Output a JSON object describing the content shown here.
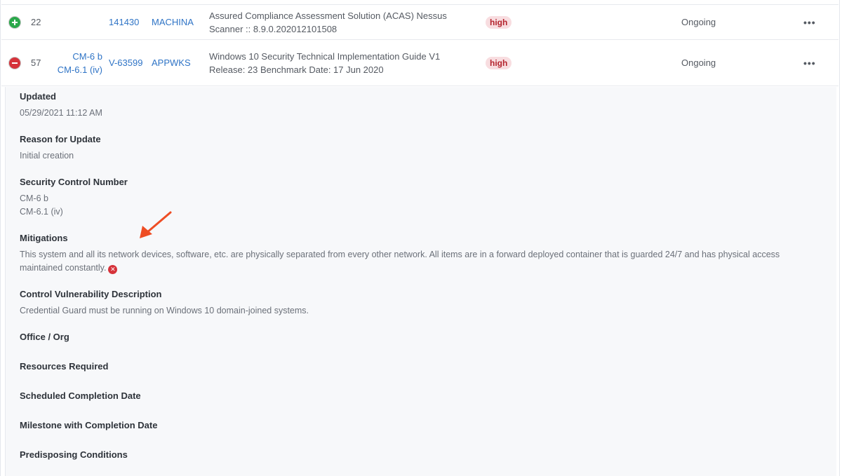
{
  "rows": [
    {
      "expanded": false,
      "number": "22",
      "control_lines": [],
      "vuln_id": "141430",
      "host": "MACHINA",
      "source_line1": "Assured Compliance Assessment Solution (ACAS) Nessus",
      "source_line2": "Scanner :: 8.9.0.202012101508",
      "severity": "high",
      "status": "Ongoing",
      "more_icon": "ellipsis-icon"
    },
    {
      "expanded": true,
      "number": "57",
      "control_lines": [
        "CM-6 b",
        "CM-6.1 (iv)"
      ],
      "vuln_id": "V-63599",
      "host": "APPWKS",
      "source_line1": "Windows 10 Security Technical Implementation Guide V1",
      "source_line2": "Release: 23 Benchmark Date: 17 Jun 2020",
      "severity": "high",
      "status": "Ongoing",
      "more_icon": "ellipsis-icon"
    }
  ],
  "detail": {
    "updated": {
      "label": "Updated",
      "value": "05/29/2021 11:12 AM"
    },
    "reason": {
      "label": "Reason for Update",
      "value": "Initial creation"
    },
    "security_control": {
      "label": "Security Control Number",
      "values": [
        "CM-6 b",
        "CM-6.1 (iv)"
      ]
    },
    "mitigations": {
      "label": "Mitigations",
      "value": "This system and all its network devices, software, etc. are physically separated from every other network. All items are in a forward deployed container that is guarded 24/7 and has physical access maintained constantly.",
      "remove_icon": "close-circle-icon"
    },
    "control_vuln_desc": {
      "label": "Control Vulnerability Description",
      "value": "Credential Guard must be running on Windows 10 domain-joined systems."
    },
    "office_org": {
      "label": "Office / Org"
    },
    "resources_required": {
      "label": "Resources Required"
    },
    "scheduled_completion": {
      "label": "Scheduled Completion Date"
    },
    "milestone": {
      "label": "Milestone with Completion Date"
    },
    "predisposing": {
      "label": "Predisposing Conditions"
    }
  },
  "colors": {
    "link": "#2f74c6",
    "severity_bg": "#f8dde0",
    "severity_text": "#b4242e",
    "expand_green": "#2aa84a",
    "collapse_red": "#d6323a",
    "annotation_arrow": "#ee4d24"
  }
}
